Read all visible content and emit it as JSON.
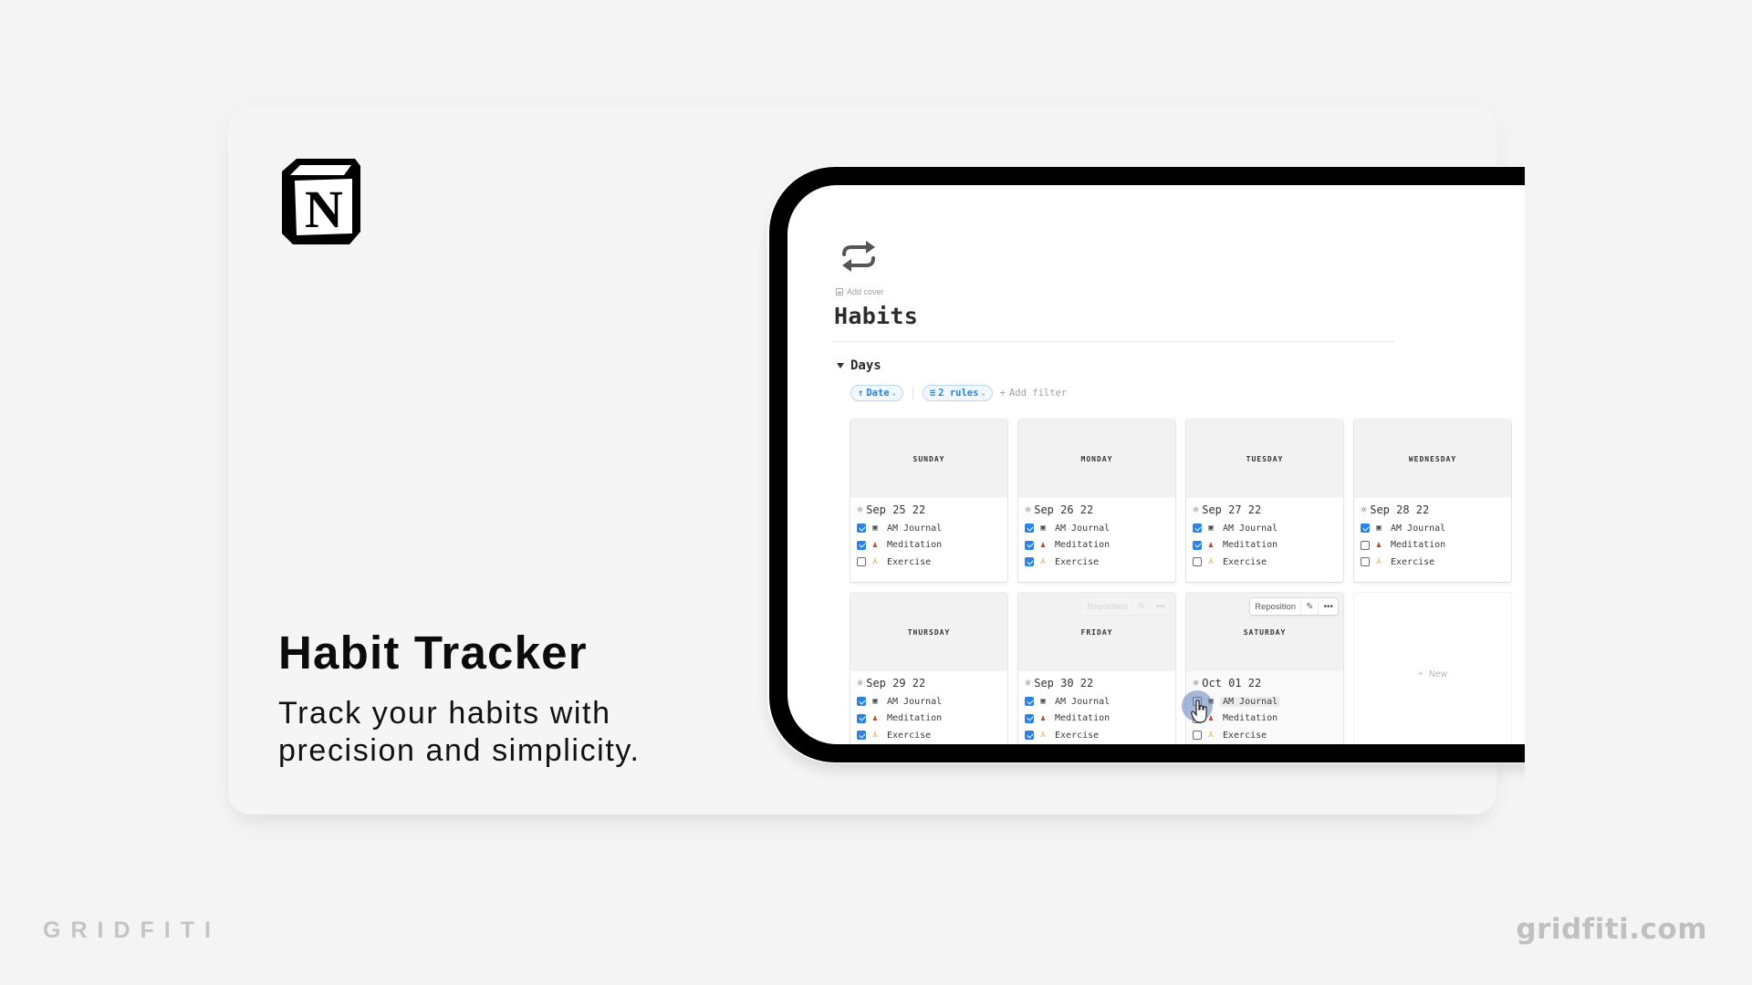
{
  "promo": {
    "logo": "notion-logo",
    "title": "Habit Tracker",
    "subtitle_lines": [
      "Track your habits with",
      "precision and simplicity."
    ],
    "brand_wordmark": "GRIDFITI",
    "brand_url": "gridfiti.com"
  },
  "notion_page": {
    "page_icon": "repeat-icon",
    "add_cover_label": "Add cover",
    "title": "Habits",
    "database": {
      "toggle_icon": "triangle-down-icon",
      "title": "Days",
      "sort_chip": {
        "arrow": "↑",
        "label": "Date",
        "caret": "⌄"
      },
      "filter_chip": {
        "icon": "≡",
        "label": "2 rules",
        "caret": "⌄"
      },
      "add_filter": {
        "plus": "+",
        "label": "Add filter"
      },
      "accent_color": "#2f7fd6",
      "checkbox_color": "#2c83e6",
      "cards": [
        {
          "day": "SUNDAY",
          "date": "Sep 25 22",
          "habits": [
            {
              "icon": "journal-icon",
              "label": "AM Journal",
              "checked": true
            },
            {
              "icon": "meditation-icon",
              "label": "Meditation",
              "checked": true
            },
            {
              "icon": "exercise-icon",
              "label": "Exercise",
              "checked": false
            }
          ]
        },
        {
          "day": "MONDAY",
          "date": "Sep 26 22",
          "habits": [
            {
              "icon": "journal-icon",
              "label": "AM Journal",
              "checked": true
            },
            {
              "icon": "meditation-icon",
              "label": "Meditation",
              "checked": true
            },
            {
              "icon": "exercise-icon",
              "label": "Exercise",
              "checked": true
            }
          ]
        },
        {
          "day": "TUESDAY",
          "date": "Sep 27 22",
          "habits": [
            {
              "icon": "journal-icon",
              "label": "AM Journal",
              "checked": true
            },
            {
              "icon": "meditation-icon",
              "label": "Meditation",
              "checked": true
            },
            {
              "icon": "exercise-icon",
              "label": "Exercise",
              "checked": false
            }
          ]
        },
        {
          "day": "WEDNESDAY",
          "date": "Sep 28 22",
          "habits": [
            {
              "icon": "journal-icon",
              "label": "AM Journal",
              "checked": true
            },
            {
              "icon": "meditation-icon",
              "label": "Meditation",
              "checked": false
            },
            {
              "icon": "exercise-icon",
              "label": "Exercise",
              "checked": false
            }
          ]
        },
        {
          "day": "THURSDAY",
          "date": "Sep 29 22",
          "habits": [
            {
              "icon": "journal-icon",
              "label": "AM Journal",
              "checked": true
            },
            {
              "icon": "meditation-icon",
              "label": "Meditation",
              "checked": true
            },
            {
              "icon": "exercise-icon",
              "label": "Exercise",
              "checked": true
            }
          ]
        },
        {
          "day": "FRIDAY",
          "date": "Sep 30 22",
          "habits": [
            {
              "icon": "journal-icon",
              "label": "AM Journal",
              "checked": true
            },
            {
              "icon": "meditation-icon",
              "label": "Meditation",
              "checked": true
            },
            {
              "icon": "exercise-icon",
              "label": "Exercise",
              "checked": true
            }
          ]
        },
        {
          "day": "SATURDAY",
          "date": "Oct 01 22",
          "habits": [
            {
              "icon": "journal-icon",
              "label": "AM Journal",
              "checked": false
            },
            {
              "icon": "meditation-icon",
              "label": "Meditation",
              "checked": false
            },
            {
              "icon": "exercise-icon",
              "label": "Exercise",
              "checked": false
            }
          ]
        }
      ],
      "card_actions": {
        "reposition_label": "Reposition",
        "edit_icon": "pencil-icon",
        "more_icon": "more-icon"
      },
      "new_card": {
        "plus": "+",
        "label": "New"
      }
    }
  }
}
